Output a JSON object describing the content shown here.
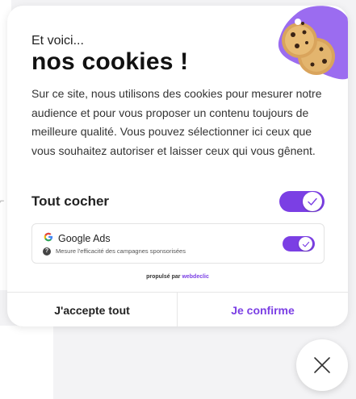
{
  "modal": {
    "eyebrow": "Et voici...",
    "title": "nos cookies !",
    "description": "Sur ce site, nous utilisons des cookies pour mesurer notre audience et pour vous proposer un contenu toujours de meilleure qualité. Vous pouvez sélectionner ici ceux que vous souhaitez autoriser et laisser ceux qui vous gênent.",
    "select_all": {
      "label": "Tout cocher",
      "checked": true
    },
    "services": [
      {
        "name": "Google Ads",
        "description": "Mesure l'efficacité des campagnes sponsorisées",
        "icon": "google-icon",
        "checked": true
      }
    ],
    "powered_by": {
      "prefix": "propulsé par",
      "brand": "webdeclic"
    },
    "buttons": {
      "accept_all": "J'accepte tout",
      "confirm": "Je confirme"
    }
  },
  "colors": {
    "accent": "#7b3fe4",
    "blob": "#9b6cf0",
    "cookie": "#d9a45c"
  },
  "close_button": {
    "icon": "close-icon"
  }
}
